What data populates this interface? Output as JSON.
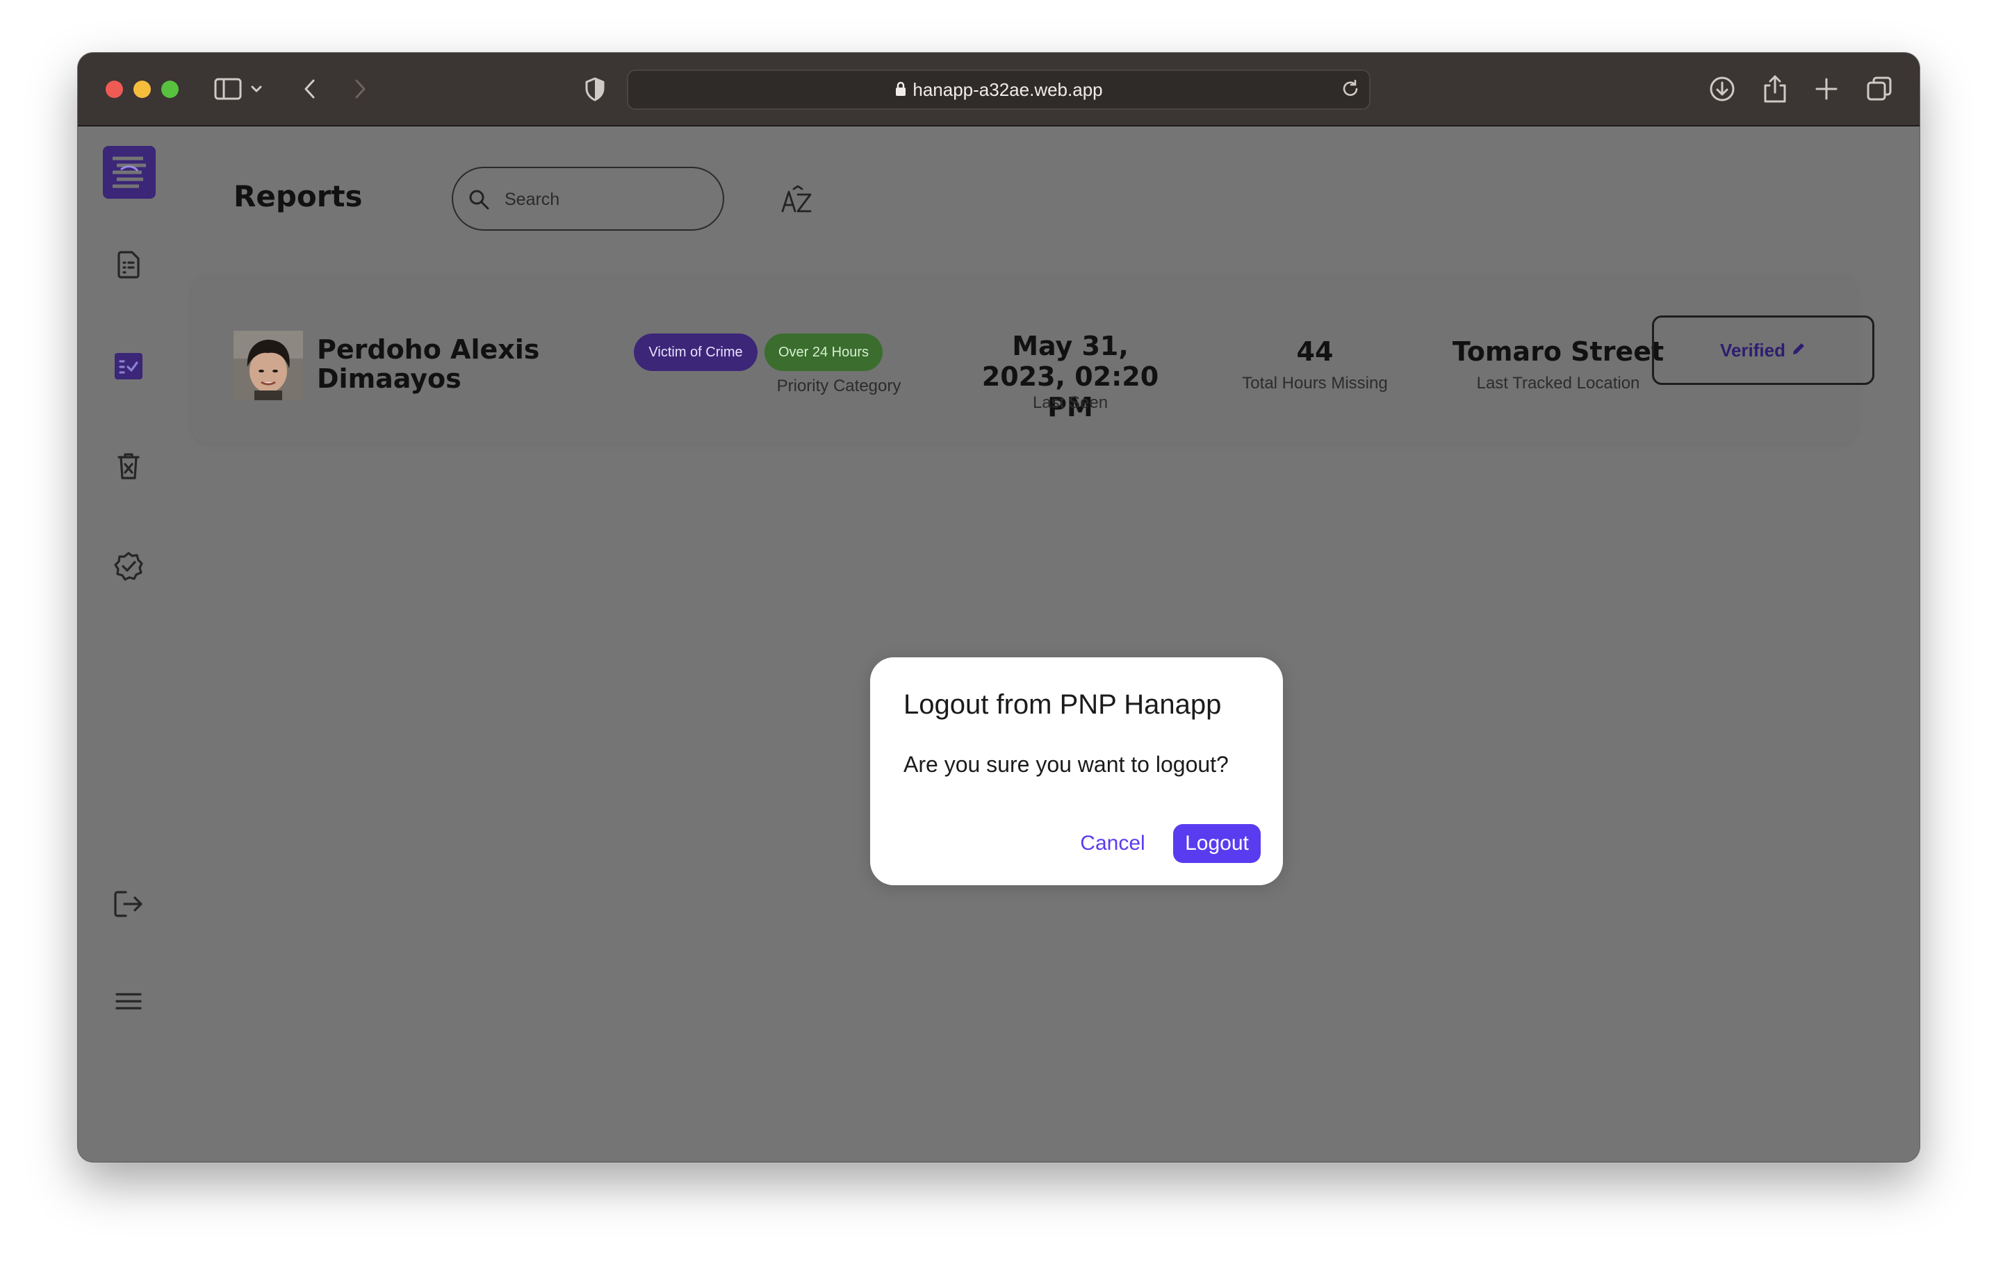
{
  "browser": {
    "url": "hanapp-a32ae.web.app"
  },
  "page": {
    "title": "Reports",
    "search_placeholder": "Search",
    "sort_label": "AZ"
  },
  "report": {
    "name": "Perdoho Alexis Dimaayos",
    "tags": [
      "Victim of Crime",
      "Over 24 Hours"
    ],
    "priority_label": "Priority Category",
    "last_seen_value": "May 31, 2023, 02:20 PM",
    "last_seen_label": "Last Seen",
    "hours_value": "44",
    "hours_label": "Total Hours Missing",
    "location_value": "Tomaro Street",
    "location_label": "Last Tracked Location",
    "verified_label": "Verified"
  },
  "modal": {
    "title": "Logout from PNP Hanapp",
    "message": "Are you sure you want to logout?",
    "cancel_label": "Cancel",
    "confirm_label": "Logout"
  },
  "colors": {
    "accent": "#5a3cf0",
    "overlay": "#757575",
    "titlebar": "#3b3533"
  }
}
